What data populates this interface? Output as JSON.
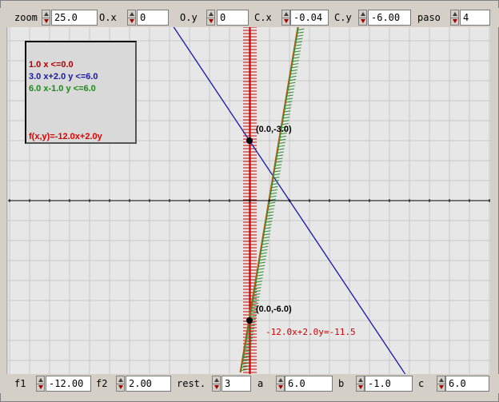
{
  "top_controls": [
    {
      "id": "zoom",
      "label": "zoom",
      "value": "25.0"
    },
    {
      "id": "ox",
      "label": "O.x",
      "value": "0"
    },
    {
      "id": "oy",
      "label": "O.y",
      "value": "0"
    },
    {
      "id": "cx",
      "label": "C.x",
      "value": "-0.04"
    },
    {
      "id": "cy",
      "label": "C.y",
      "value": "-6.00"
    },
    {
      "id": "paso",
      "label": "paso",
      "value": "4"
    }
  ],
  "bottom_controls": [
    {
      "id": "f1",
      "label": "f1",
      "value": "-12.00"
    },
    {
      "id": "f2",
      "label": "f2",
      "value": "2.00"
    },
    {
      "id": "rest",
      "label": "rest.",
      "value": "3"
    },
    {
      "id": "a",
      "label": "a",
      "value": "6.0"
    },
    {
      "id": "b",
      "label": "b",
      "value": "-1.0"
    },
    {
      "id": "c",
      "label": "c",
      "value": "6.0"
    }
  ],
  "legend": {
    "constraints": [
      {
        "text": "1.0 x <=0.0",
        "color": "#b00000"
      },
      {
        "text": "3.0 x+2.0 y <=6.0",
        "color": "#1a1aa0"
      },
      {
        "text": "6.0 x-1.0 y <=6.0",
        "color": "#1a8a1a"
      }
    ],
    "objective": {
      "text": "f(x,y)=-12.0x+2.0y",
      "color": "#e00000"
    }
  },
  "points": [
    {
      "label": "(0.0,-3.0)",
      "x": 0,
      "y": 3
    },
    {
      "label": "(0.0,-6.0)",
      "x": 0,
      "y": -6
    }
  ],
  "objective_line_label": "-12.0x+2.0y=-11.5",
  "colors": {
    "red": "#c80000",
    "blue": "#1c1cae",
    "green": "#2a8a2a",
    "orange": "#b06010",
    "grid": "#c8c8c8",
    "axis": "#000000"
  }
}
